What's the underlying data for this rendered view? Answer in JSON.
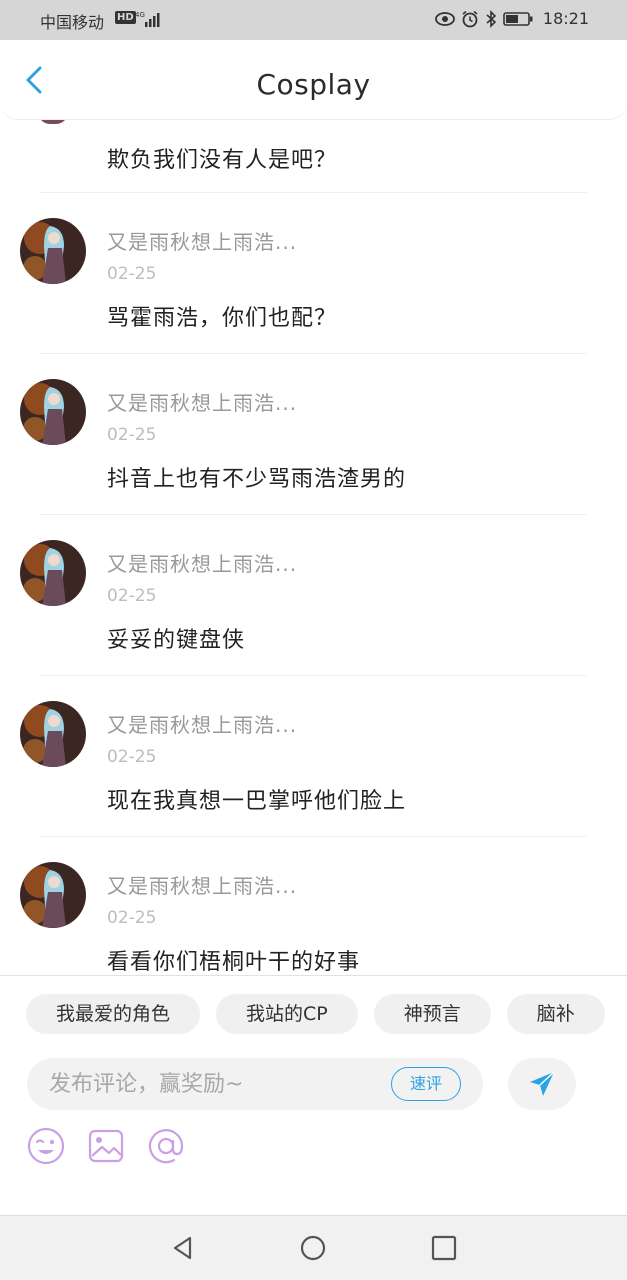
{
  "status_bar": {
    "carrier": "中国移动",
    "hd": "HD",
    "network": "4G",
    "time": "18:21"
  },
  "header": {
    "title": "Cosplay"
  },
  "partial_comment": {
    "text": "欺负我们没有人是吧？"
  },
  "comments": [
    {
      "name": "又是雨秋想上雨浩...",
      "date": "02-25",
      "text": "骂霍雨浩，你们也配？"
    },
    {
      "name": "又是雨秋想上雨浩...",
      "date": "02-25",
      "text": "抖音上也有不少骂雨浩渣男的"
    },
    {
      "name": "又是雨秋想上雨浩...",
      "date": "02-25",
      "text": "妥妥的键盘侠"
    },
    {
      "name": "又是雨秋想上雨浩...",
      "date": "02-25",
      "text": "现在我真想一巴掌呼他们脸上"
    },
    {
      "name": "又是雨秋想上雨浩...",
      "date": "02-25",
      "text": "看看你们梧桐叶干的好事"
    }
  ],
  "composer": {
    "tags": [
      "我最爱的角色",
      "我站的CP",
      "神预言",
      "脑补"
    ],
    "input_placeholder": "发布评论，赢奖励~",
    "quick_review_label": "速评",
    "tool_icons": [
      "emoji-icon",
      "image-icon",
      "at-icon"
    ],
    "accent_color": "#2aa3e3",
    "tool_icon_color": "#c9a0e6"
  },
  "nav_bar": {
    "icons": [
      "back-triangle-icon",
      "home-circle-icon",
      "recent-square-icon"
    ]
  }
}
